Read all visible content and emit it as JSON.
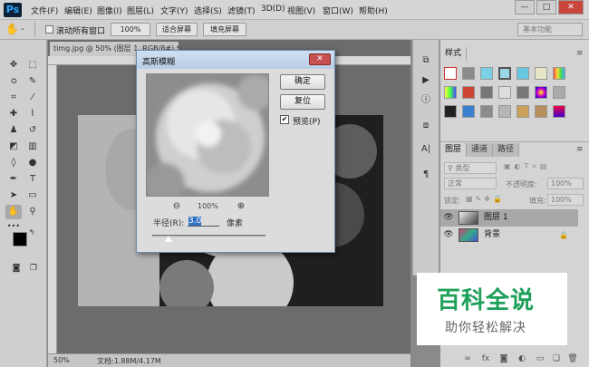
{
  "app": {
    "logo": "Ps"
  },
  "menu": [
    "文件(F)",
    "编辑(E)",
    "图像(I)",
    "图层(L)",
    "文字(Y)",
    "选择(S)",
    "滤镜(T)",
    "3D(D)",
    "视图(V)",
    "窗口(W)",
    "帮助(H)"
  ],
  "window_buttons": {
    "minimize": "—",
    "maximize": "□",
    "close": "✕"
  },
  "options_bar": {
    "tool_icon": "hand-icon",
    "scroll_all_label": "滚动所有窗口",
    "zoom_100": "100%",
    "fit_screen": "适合屏幕",
    "fill_screen": "填充屏幕",
    "workspace": "基本功能"
  },
  "document": {
    "tab_title": "timg.jpg @ 50% (图层 1, RGB/8#) *",
    "zoom": "50%",
    "doc_size": "文档:1.88M/4.17M"
  },
  "dialog": {
    "title": "高斯模糊",
    "ok": "确定",
    "reset": "复位",
    "preview_label": "预览(P)",
    "preview_checked": true,
    "zoom_percent": "100%",
    "radius_label": "半径(R):",
    "radius_value": "3.0",
    "radius_unit": "像素",
    "zoom_out_icon": "zoom-out-icon",
    "zoom_in_icon": "zoom-in-icon"
  },
  "swatches_panel": {
    "tab": "样式"
  },
  "layers_panel": {
    "tabs": [
      "图层",
      "通道",
      "路径"
    ],
    "kind_filter": "类型",
    "blend_mode": "正常",
    "opacity_label": "不透明度:",
    "opacity_value": "100%",
    "lock_label": "锁定:",
    "fill_label": "填充:",
    "fill_value": "100%",
    "layers": [
      {
        "name": "图层 1",
        "selected": true
      },
      {
        "name": "背景",
        "selected": false,
        "locked": true
      }
    ]
  },
  "watermark": {
    "title": "百科全说",
    "subtitle": "助你轻松解决"
  }
}
